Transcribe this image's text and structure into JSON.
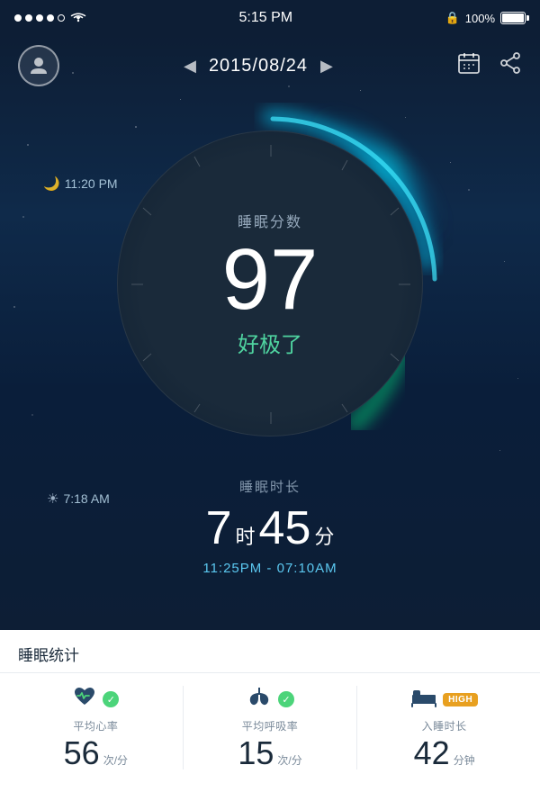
{
  "statusBar": {
    "time": "5:15 PM",
    "battery": "100%"
  },
  "header": {
    "prevArrow": "◀",
    "date": "2015/08/24",
    "nextArrow": "▶"
  },
  "sleepStart": {
    "icon": "🌙",
    "time": "11:20 PM"
  },
  "sleepEnd": {
    "icon": "☀",
    "time": "7:18 AM"
  },
  "scoreSection": {
    "label": "睡眠分数",
    "score": "97",
    "rating": "好极了"
  },
  "durationSection": {
    "label": "睡眠时长",
    "hours": "7",
    "hoursUnit": "时",
    "minutes": "45",
    "minutesUnit": "分",
    "range": "11:25PM - 07:10AM"
  },
  "statsSection": {
    "title": "睡眠统计",
    "items": [
      {
        "iconSymbol": "♥",
        "badgeType": "check",
        "name": "平均心率",
        "value": "56",
        "unit": "次/分"
      },
      {
        "iconSymbol": "🫁",
        "badgeType": "check",
        "name": "平均呼吸率",
        "value": "15",
        "unit": "次/分"
      },
      {
        "iconSymbol": "🛏",
        "badgeType": "high",
        "name": "入睡时长",
        "value": "42",
        "unit": "分钟"
      }
    ],
    "highLabel": "HIGH"
  }
}
